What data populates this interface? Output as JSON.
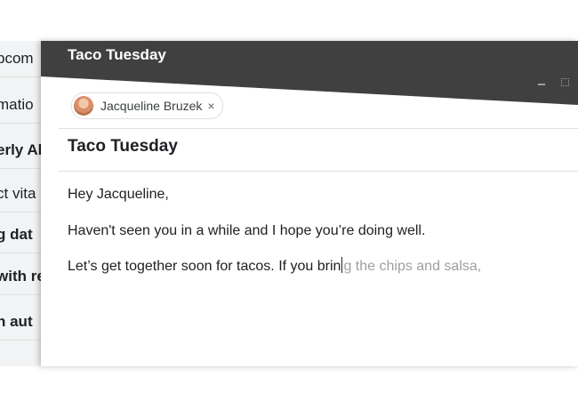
{
  "inbox": {
    "rows": [
      {
        "text": "pcom",
        "bold": false
      },
      {
        "text": "matio",
        "bold": false
      },
      {
        "text": "erly Al",
        "bold": true
      },
      {
        "text": "ct vita",
        "bold": false
      },
      {
        "text": "g dat",
        "bold": true
      },
      {
        "text": "with re",
        "bold": true
      },
      {
        "text": "n aut",
        "bold": true
      }
    ]
  },
  "compose": {
    "window_title": "Taco Tuesday",
    "recipient": {
      "name": "Jacqueline Bruzek",
      "remove_symbol": "×"
    },
    "subject": "Taco Tuesday",
    "body": {
      "greeting": "Hey Jacqueline,",
      "line2": "Haven't seen you in a while and I hope you’re doing well.",
      "line3_typed": "Let’s get together soon for tacos. If you brin",
      "line3_suggestion": "g the chips and salsa,"
    }
  }
}
